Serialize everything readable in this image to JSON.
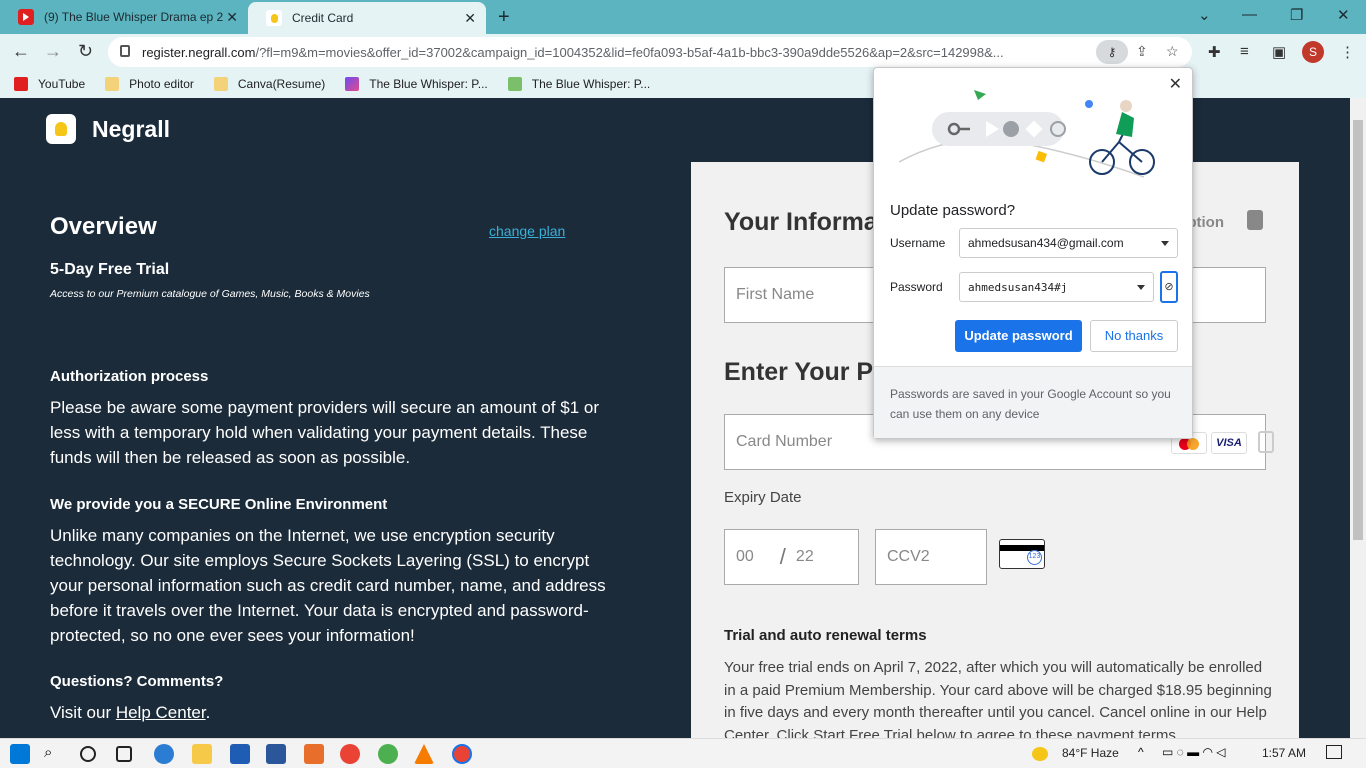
{
  "browser": {
    "tabs": [
      {
        "title": "(9) The Blue Whisper Drama ep 2",
        "close": "✕"
      },
      {
        "title": "Credit Card",
        "close": "✕"
      }
    ],
    "new_tab": "+",
    "window_controls": {
      "dropdown": "⌄",
      "minimize": "—",
      "restore": "❐",
      "close": "✕"
    },
    "nav": {
      "back": "←",
      "forward": "→",
      "reload": "↻"
    },
    "url_domain": "register.negrall.com",
    "url_rest": "/?fl=m9&m=movies&offer_id=37002&campaign_id=1004352&lid=fe0fa093-b5af-4a1b-bbc3-390a9dde5526&ap=2&src=142998&...",
    "profile_initial": "S",
    "bookmarks": [
      "YouTube",
      "Photo editor",
      "Canva(Resume)",
      "The Blue Whisper: P...",
      "The Blue Whisper: P..."
    ]
  },
  "page": {
    "brand": "Negrall",
    "overview": "Overview",
    "change_plan": "change plan",
    "trial_title": "5-Day Free Trial",
    "trial_sub": "Access to our Premium catalogue of Games, Music, Books & Movies",
    "auth_title": "Authorization process",
    "auth_text": "Please be aware some payment providers will secure an amount of $1 or less with a temporary hold when validating your payment details. These funds will then be released as soon as possible.",
    "secure_title": "We provide you a SECURE Online Environment",
    "secure_text": "Unlike many companies on the Internet, we use encryption security technology. Our site employs Secure Sockets Layering (SSL) to encrypt your personal information such as credit card number, name, and address before it travels over the Internet. Your data is encrypted and password-protected, so no one ever sees your information!",
    "questions_title": "Questions? Comments?",
    "visit_prefix": "Visit our ",
    "help_center": "Help Center",
    "visit_suffix": ".",
    "form": {
      "your_info": "Your Informa",
      "encryption": "yption",
      "first_name_placeholder": "First Name",
      "enter_your": "Enter Your P",
      "card_number_placeholder": "Card Number",
      "visa": "VISA",
      "expiry_label": "Expiry Date",
      "month": "00",
      "slash": "/",
      "year": "22",
      "ccv": "CCV2",
      "cvc_hint": "123",
      "terms_title": "Trial and auto renewal terms",
      "terms_text": "Your free trial ends on April 7, 2022, after which you will automatically be enrolled in a paid Premium Membership. Your card above will be charged $18.95 beginning in five days and every month thereafter until you cancel. Cancel online in our Help Center. Click Start Free Trial below to agree to these payment terms."
    }
  },
  "password_popup": {
    "title": "Update password?",
    "username_label": "Username",
    "username": "ahmedsusan434@gmail.com",
    "password_label": "Password",
    "password": "ahmedsusan434#j",
    "update_button": "Update password",
    "no_thanks_button": "No thanks",
    "footer": "Passwords are saved in your Google Account so you can use them on any device"
  },
  "taskbar": {
    "weather": "84°F  Haze",
    "time": "1:57 AM"
  },
  "colors": {
    "page_bg": "#1b2b3a",
    "accent_blue": "#1a73e8",
    "tabbar": "#5bb4c0",
    "link": "#3ab0d8"
  }
}
